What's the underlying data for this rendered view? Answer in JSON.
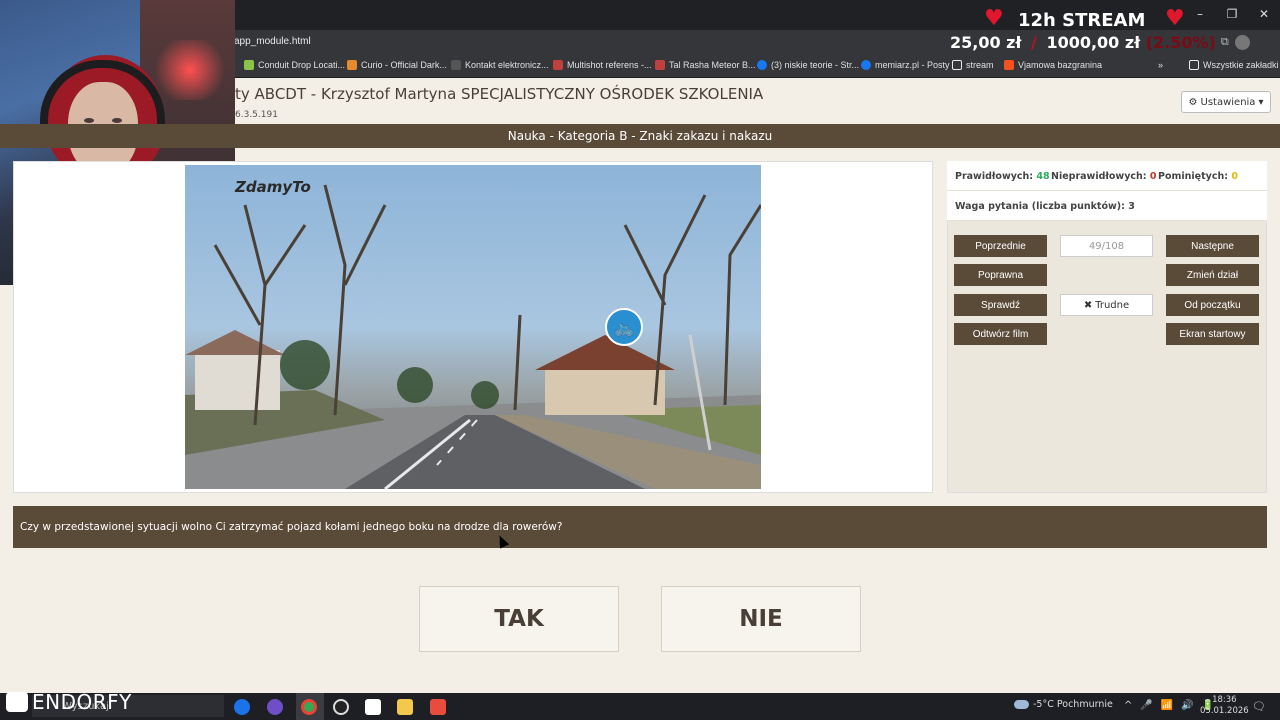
{
  "browser": {
    "address": "app_module.html",
    "window_controls": [
      "–",
      "❐",
      "✕"
    ],
    "bookmarks": [
      {
        "label": "Conduit Drop Locati...",
        "color": "#8bc34a"
      },
      {
        "label": "Curio - Official Dark...",
        "color": "#e68a2e"
      },
      {
        "label": "Kontakt elektronicz...",
        "color": "#555555"
      },
      {
        "label": "Multishot referens -...",
        "color": "#c04040"
      },
      {
        "label": "Tal Rasha Meteor B...",
        "color": "#c04040"
      },
      {
        "label": "(3) niskie teorie - Str...",
        "color": "#1877f2"
      },
      {
        "label": "memiarz.pl - Posty",
        "color": "#1877f2"
      },
      {
        "label": "stream",
        "color": "#e8eaed"
      },
      {
        "label": "Vjamowa bazgranina",
        "color": "#f4511e"
      }
    ],
    "bookmarks_more": "»",
    "all_bookmarks": "Wszystkie zakładki"
  },
  "stream_overlay": {
    "title": "12h STREAM",
    "raised": "25,00 zł",
    "separator": "/",
    "goal": "1000,00 zł",
    "percent": "(2.50%)"
  },
  "app": {
    "title": "ty ABCDT - Krzysztof Martyna SPECJALISTYCZNY OŚRODEK SZKOLENIA",
    "version": "6.3.5.191",
    "settings_icon": "⚙",
    "settings_label": "Ustawienia",
    "settings_caret": "▾",
    "section": "Nauka - Kategoria B - Znaki zakazu i nakazu"
  },
  "media": {
    "watermark": "ZdamyTo"
  },
  "stats": {
    "correct_label": "Prawidłowych:",
    "correct_value": "48",
    "correct_color": "#27ae60",
    "incorrect_label": "Nieprawidłowych:",
    "incorrect_value": "0",
    "incorrect_color": "#c0392b",
    "skipped_label": "Pominiętych:",
    "skipped_value": "0",
    "skipped_color": "#e6b800",
    "weight_label": "Waga pytania (liczba punktów):",
    "weight_value": "3"
  },
  "controls": {
    "previous": "Poprzednie",
    "counter": "49/108",
    "next": "Następne",
    "correct_answer": "Poprawna",
    "change_section": "Zmień dział",
    "check": "Sprawdź",
    "hard_icon": "✖",
    "hard": "Trudne",
    "from_start": "Od początku",
    "play_video": "Odtwórz film",
    "start_screen": "Ekran startowy"
  },
  "question": {
    "text": "Czy w przedstawionej sytuacji wolno Ci zatrzymać pojazd kołami jednego boku na drodze dla rowerów?",
    "answer_yes": "TAK",
    "answer_no": "NIE"
  },
  "taskbar": {
    "brand": "ENDORFY",
    "search_placeholder": "Wyszukaj",
    "weather": "-5°C  Pochmurnie",
    "tray": [
      "^",
      "🎤",
      "📶",
      "🔊",
      "🔋"
    ],
    "time": "18:36",
    "date": "05.01.2026",
    "notifications_icon": "🗨"
  }
}
